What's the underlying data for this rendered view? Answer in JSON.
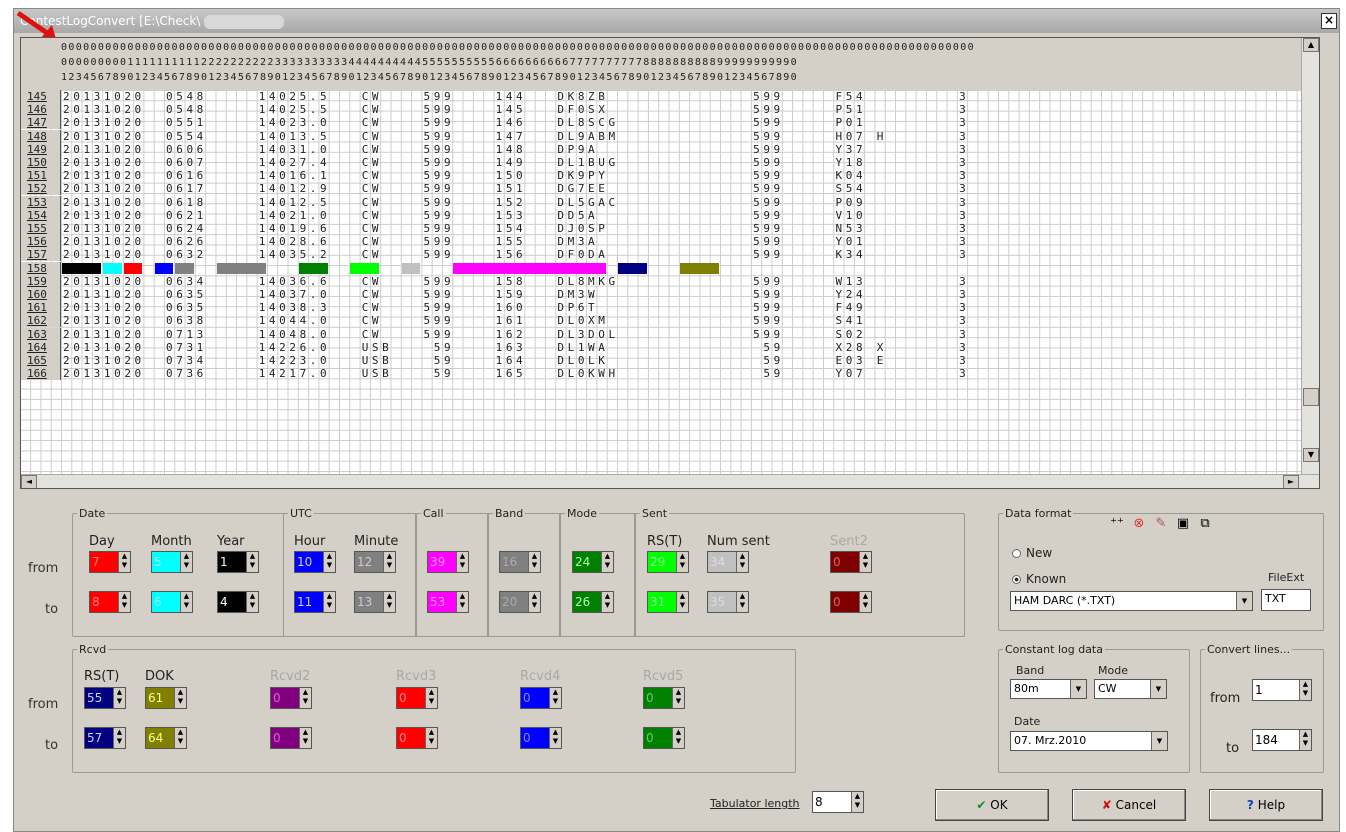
{
  "window": {
    "title": "ContestLogConvert [E:\\Check\\",
    "close": "×"
  },
  "header": {
    "row1": "0000000000000000000000000000000000000000000000000000000000000000000000000000000000000000000000000000000000000000000000000000",
    "row2": "0000000001111111111222222222233333333334444444444555555555566666666667777777777888888888899999999990",
    "row3": "1234567890123456789012345678901234567890123456789012345678901234567890123456789012345678901234567890"
  },
  "rows": [
    {
      "n": "145",
      "d": "20131020",
      "t": "0548",
      "f": "14025.5",
      "m": "CW",
      "rst": "599",
      "num": "144",
      "call": "DK8ZB",
      "rr": "599",
      "dok": "F54",
      "x": "",
      "b": "3"
    },
    {
      "n": "146",
      "d": "20131020",
      "t": "0548",
      "f": "14025.5",
      "m": "CW",
      "rst": "599",
      "num": "145",
      "call": "DF0SX",
      "rr": "599",
      "dok": "P51",
      "x": "",
      "b": "3"
    },
    {
      "n": "147",
      "d": "20131020",
      "t": "0551",
      "f": "14023.0",
      "m": "CW",
      "rst": "599",
      "num": "146",
      "call": "DL8SCG",
      "rr": "599",
      "dok": "P01",
      "x": "",
      "b": "3"
    },
    {
      "n": "148",
      "d": "20131020",
      "t": "0554",
      "f": "14013.5",
      "m": "CW",
      "rst": "599",
      "num": "147",
      "call": "DL9ABM",
      "rr": "599",
      "dok": "H07",
      "x": "H",
      "b": "3"
    },
    {
      "n": "149",
      "d": "20131020",
      "t": "0606",
      "f": "14031.0",
      "m": "CW",
      "rst": "599",
      "num": "148",
      "call": "DP9A",
      "rr": "599",
      "dok": "Y37",
      "x": "",
      "b": "3"
    },
    {
      "n": "150",
      "d": "20131020",
      "t": "0607",
      "f": "14027.4",
      "m": "CW",
      "rst": "599",
      "num": "149",
      "call": "DL1BUG",
      "rr": "599",
      "dok": "Y18",
      "x": "",
      "b": "3"
    },
    {
      "n": "151",
      "d": "20131020",
      "t": "0616",
      "f": "14016.1",
      "m": "CW",
      "rst": "599",
      "num": "150",
      "call": "DK9PY",
      "rr": "599",
      "dok": "K04",
      "x": "",
      "b": "3"
    },
    {
      "n": "152",
      "d": "20131020",
      "t": "0617",
      "f": "14012.9",
      "m": "CW",
      "rst": "599",
      "num": "151",
      "call": "DG7EE",
      "rr": "599",
      "dok": "S54",
      "x": "",
      "b": "3"
    },
    {
      "n": "153",
      "d": "20131020",
      "t": "0618",
      "f": "14012.5",
      "m": "CW",
      "rst": "599",
      "num": "152",
      "call": "DL5GAC",
      "rr": "599",
      "dok": "P09",
      "x": "",
      "b": "3"
    },
    {
      "n": "154",
      "d": "20131020",
      "t": "0621",
      "f": "14021.0",
      "m": "CW",
      "rst": "599",
      "num": "153",
      "call": "DD5A",
      "rr": "599",
      "dok": "V10",
      "x": "",
      "b": "3"
    },
    {
      "n": "155",
      "d": "20131020",
      "t": "0624",
      "f": "14019.6",
      "m": "CW",
      "rst": "599",
      "num": "154",
      "call": "DJ0SP",
      "rr": "599",
      "dok": "N53",
      "x": "",
      "b": "3"
    },
    {
      "n": "156",
      "d": "20131020",
      "t": "0626",
      "f": "14028.6",
      "m": "CW",
      "rst": "599",
      "num": "155",
      "call": "DM3A",
      "rr": "599",
      "dok": "Y01",
      "x": "",
      "b": "3"
    },
    {
      "n": "157",
      "d": "20131020",
      "t": "0632",
      "f": "14035.2",
      "m": "CW",
      "rst": "599",
      "num": "156",
      "call": "DF0DA",
      "rr": "599",
      "dok": "K34",
      "x": "",
      "b": "3"
    },
    {
      "n": "158",
      "d": "",
      "t": "",
      "f": "",
      "m": "",
      "rst": "",
      "num": "",
      "call": "",
      "rr": "",
      "dok": "",
      "x": "",
      "b": ""
    },
    {
      "n": "159",
      "d": "20131020",
      "t": "0634",
      "f": "14036.6",
      "m": "CW",
      "rst": "599",
      "num": "158",
      "call": "DL8MKG",
      "rr": "599",
      "dok": "W13",
      "x": "",
      "b": "3"
    },
    {
      "n": "160",
      "d": "20131020",
      "t": "0635",
      "f": "14037.0",
      "m": "CW",
      "rst": "599",
      "num": "159",
      "call": "DM3W",
      "rr": "599",
      "dok": "Y24",
      "x": "",
      "b": "3"
    },
    {
      "n": "161",
      "d": "20131020",
      "t": "0635",
      "f": "14038.3",
      "m": "CW",
      "rst": "599",
      "num": "160",
      "call": "DP6T",
      "rr": "599",
      "dok": "F49",
      "x": "",
      "b": "3"
    },
    {
      "n": "162",
      "d": "20131020",
      "t": "0638",
      "f": "14044.0",
      "m": "CW",
      "rst": "599",
      "num": "161",
      "call": "DL0XM",
      "rr": "599",
      "dok": "S41",
      "x": "",
      "b": "3"
    },
    {
      "n": "163",
      "d": "20131020",
      "t": "0713",
      "f": "14048.0",
      "m": "CW",
      "rst": "599",
      "num": "162",
      "call": "DL3DOL",
      "rr": "599",
      "dok": "S02",
      "x": "",
      "b": "3"
    },
    {
      "n": "164",
      "d": "20131020",
      "t": "0731",
      "f": "14226.0",
      "m": "USB",
      "rst": "59",
      "num": "163",
      "call": "DL1WA",
      "rr": "59",
      "dok": "X28",
      "x": "X",
      "b": "3"
    },
    {
      "n": "165",
      "d": "20131020",
      "t": "0734",
      "f": "14223.0",
      "m": "USB",
      "rst": "59",
      "num": "164",
      "call": "DL0LK",
      "rr": "59",
      "dok": "E03",
      "x": "E",
      "b": "3"
    },
    {
      "n": "166",
      "d": "20131020",
      "t": "0736",
      "f": "14217.0",
      "m": "USB",
      "rst": "59",
      "num": "165",
      "call": "DL0KWH",
      "rr": "59",
      "dok": "Y07",
      "x": "",
      "b": "3"
    }
  ],
  "marks": [
    {
      "c": "#000000",
      "from": 1,
      "to": 4
    },
    {
      "c": "#00ffff",
      "from": 5,
      "to": 6
    },
    {
      "c": "#ff0000",
      "from": 7,
      "to": 8
    },
    {
      "c": "#0000ff",
      "from": 10,
      "to": 11
    },
    {
      "c": "#808080",
      "from": 12,
      "to": 13
    },
    {
      "c": "#808080",
      "from": 16,
      "to": 20
    },
    {
      "c": "#008000",
      "from": 24,
      "to": 26
    },
    {
      "c": "#00ff00",
      "from": 29,
      "to": 31
    },
    {
      "c": "#c0c0c0",
      "from": 34,
      "to": 35
    },
    {
      "c": "#ff00ff",
      "from": 39,
      "to": 53
    },
    {
      "c": "#000080",
      "from": 55,
      "to": 57
    },
    {
      "c": "#808000",
      "from": 61,
      "to": 64
    }
  ],
  "groups": {
    "date": "Date",
    "utc": "UTC",
    "call": "Call",
    "band": "Band",
    "mode": "Mode",
    "sent": "Sent",
    "rcvd": "Rcvd",
    "from": "from",
    "to": "to",
    "day": "Day",
    "month": "Month",
    "year": "Year",
    "hour": "Hour",
    "minute": "Minute",
    "rst": "RS(T)",
    "numsent": "Num sent",
    "sent2": "Sent2",
    "rrst": "RS(T)",
    "dok": "DOK",
    "rcvd2": "Rcvd2",
    "rcvd3": "Rcvd3",
    "rcvd4": "Rcvd4",
    "rcvd5": "Rcvd5"
  },
  "spins": {
    "day": [
      "7",
      "8"
    ],
    "month": [
      "5",
      "6"
    ],
    "year": [
      "1",
      "4"
    ],
    "hour": [
      "10",
      "11"
    ],
    "minute": [
      "12",
      "13"
    ],
    "call": [
      "39",
      "53"
    ],
    "band": [
      "16",
      "20"
    ],
    "mode": [
      "24",
      "26"
    ],
    "rst": [
      "29",
      "31"
    ],
    "numsent": [
      "34",
      "35"
    ],
    "sent2": [
      "0",
      "0"
    ],
    "rrst": [
      "55",
      "57"
    ],
    "dok": [
      "61",
      "64"
    ],
    "rcvd2": [
      "0",
      "0"
    ],
    "rcvd3": [
      "0",
      "0"
    ],
    "rcvd4": [
      "0",
      "0"
    ],
    "rcvd5": [
      "0",
      "0"
    ]
  },
  "dataformat": {
    "title": "Data format",
    "new": "New",
    "known": "Known",
    "fileext_label": "FileExt",
    "format": "HAM DARC (*.TXT)",
    "fileext": "TXT"
  },
  "constant": {
    "title": "Constant log data",
    "band_label": "Band",
    "mode_label": "Mode",
    "band": "80m",
    "mode": "CW",
    "date_label": "Date",
    "date": "07. Mrz.2010"
  },
  "convert": {
    "title": "Convert lines...",
    "from_label": "from",
    "from": "1",
    "to_label": "to",
    "to": "184"
  },
  "tab": {
    "label": "Tabulator length",
    "value": "8"
  },
  "buttons": {
    "ok": "OK",
    "cancel": "Cancel",
    "help": "Help"
  }
}
